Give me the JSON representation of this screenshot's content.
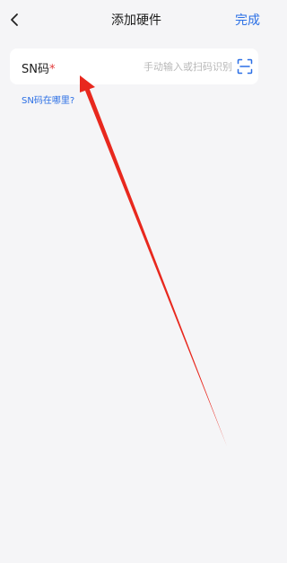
{
  "header": {
    "back_icon": "chevron-left-icon",
    "title": "添加硬件",
    "done_label": "完成"
  },
  "sn_field": {
    "label": "SN码",
    "required_mark": "*",
    "placeholder": "手动输入或扫码识别",
    "value": "",
    "scan_icon": "scan-frame-icon"
  },
  "help_link": "SN码在哪里?",
  "colors": {
    "background": "#f5f5f7",
    "accent": "#2b6fe5",
    "required": "#e23b3b",
    "annotation_arrow": "#e8281e"
  }
}
